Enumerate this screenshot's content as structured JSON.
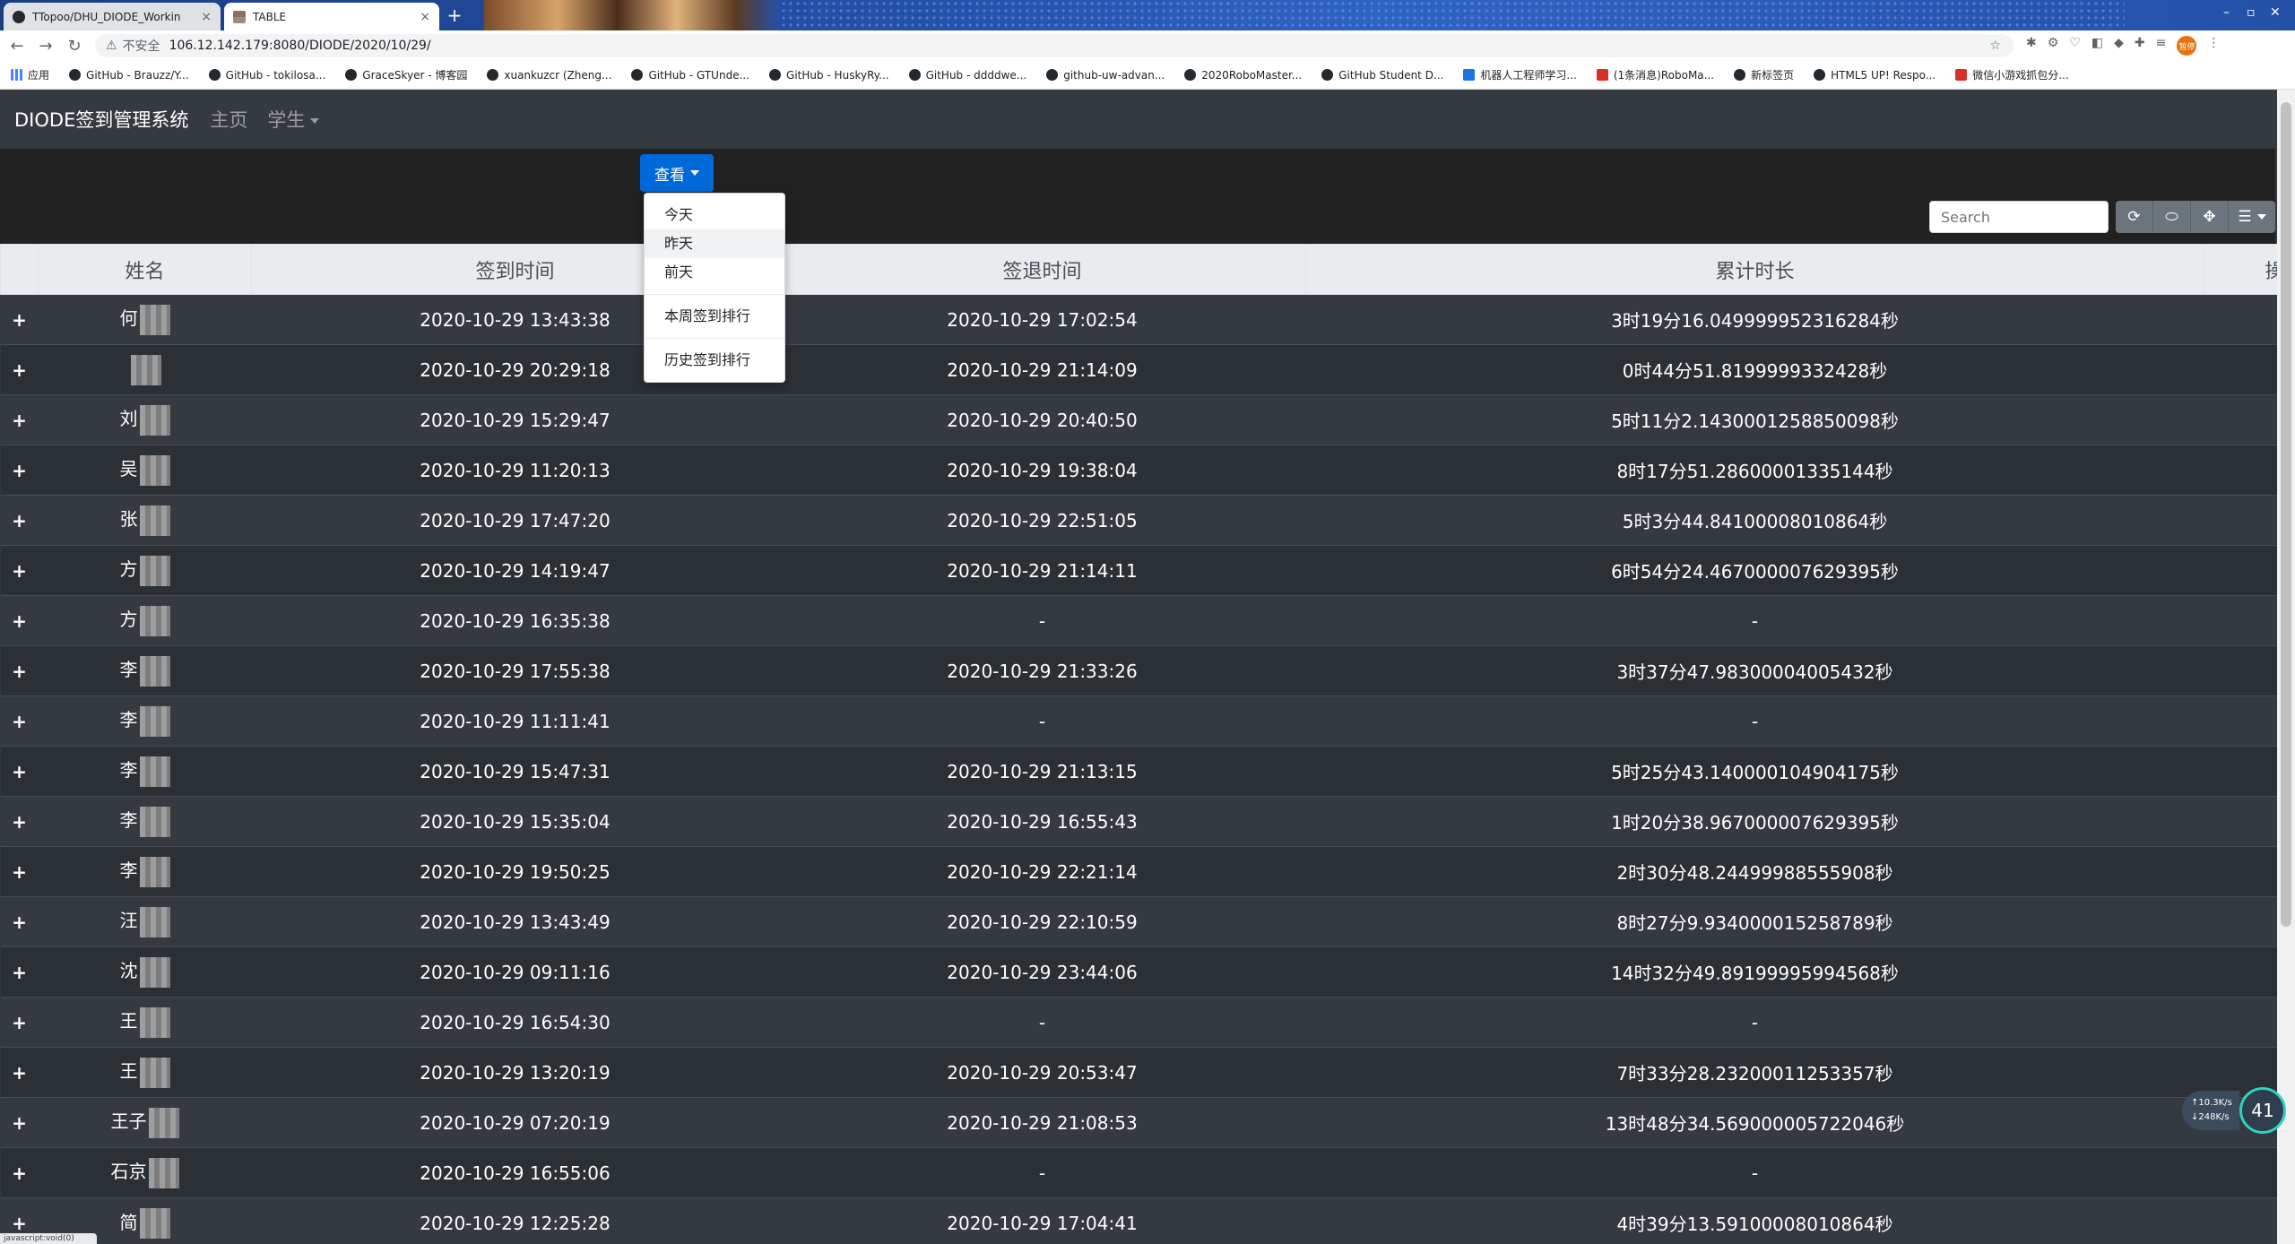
{
  "browser": {
    "tabs": [
      {
        "title": "TTopoo/DHU_DIODE_Workin",
        "close": "×"
      },
      {
        "title": "TABLE",
        "close": "×"
      }
    ],
    "new_tab": "+",
    "address": {
      "insecure_label": "不安全",
      "url": "106.12.142.179:8080/DIODE/2020/10/29/"
    },
    "profile_chip": "暂停",
    "bookmarks": [
      "应用",
      "GitHub - Brauzz/Y...",
      "GitHub - tokilosa...",
      "GraceSkyer - 博客园",
      "xuankuzcr (Zheng...",
      "GitHub - GTUnde...",
      "GitHub - HuskyRy...",
      "GitHub - ddddwe...",
      "github-uw-advan...",
      "2020RoboMaster...",
      "GitHub Student D...",
      "机器人工程师学习...",
      "(1条消息)RoboMa...",
      "新标签页",
      "HTML5 UP! Respo...",
      "微信小游戏抓包分..."
    ],
    "status_url": "javascript:void(0)"
  },
  "navbar": {
    "brand": "DIODE签到管理系统",
    "home": "主页",
    "student": "学生"
  },
  "toolbar": {
    "view_button": "查看",
    "search_placeholder": "Search",
    "icons": [
      "refresh-icon",
      "toggle-icon",
      "fullscreen-icon",
      "columns-icon"
    ]
  },
  "dropdown": {
    "items": [
      "今天",
      "昨天",
      "前天",
      "本周签到排行",
      "历史签到排行"
    ],
    "hovered": "昨天"
  },
  "table": {
    "columns": [
      "姓名",
      "签到时间",
      "签退时间",
      "累计时长",
      "操作"
    ],
    "rows": [
      {
        "name": "何",
        "checkin": "2020-10-29 13:43:38",
        "checkout": "2020-10-29 17:02:54",
        "duration": "3时19分16.049999952316284秒"
      },
      {
        "name": "",
        "checkin": "2020-10-29 20:29:18",
        "checkout": "2020-10-29 21:14:09",
        "duration": "0时44分51.8199999332428秒"
      },
      {
        "name": "刘",
        "checkin": "2020-10-29 15:29:47",
        "checkout": "2020-10-29 20:40:50",
        "duration": "5时11分2.1430001258850098秒"
      },
      {
        "name": "吴",
        "checkin": "2020-10-29 11:20:13",
        "checkout": "2020-10-29 19:38:04",
        "duration": "8时17分51.28600001335144秒"
      },
      {
        "name": "张",
        "checkin": "2020-10-29 17:47:20",
        "checkout": "2020-10-29 22:51:05",
        "duration": "5时3分44.84100008010864秒"
      },
      {
        "name": "方",
        "checkin": "2020-10-29 14:19:47",
        "checkout": "2020-10-29 21:14:11",
        "duration": "6时54分24.467000007629395秒"
      },
      {
        "name": "方",
        "checkin": "2020-10-29 16:35:38",
        "checkout": "-",
        "duration": "-"
      },
      {
        "name": "李",
        "checkin": "2020-10-29 17:55:38",
        "checkout": "2020-10-29 21:33:26",
        "duration": "3时37分47.98300004005432秒"
      },
      {
        "name": "李",
        "checkin": "2020-10-29 11:11:41",
        "checkout": "-",
        "duration": "-"
      },
      {
        "name": "李",
        "checkin": "2020-10-29 15:47:31",
        "checkout": "2020-10-29 21:13:15",
        "duration": "5时25分43.140000104904175秒"
      },
      {
        "name": "李",
        "checkin": "2020-10-29 15:35:04",
        "checkout": "2020-10-29 16:55:43",
        "duration": "1时20分38.967000007629395秒"
      },
      {
        "name": "李",
        "checkin": "2020-10-29 19:50:25",
        "checkout": "2020-10-29 22:21:14",
        "duration": "2时30分48.24499988555908秒"
      },
      {
        "name": "汪",
        "checkin": "2020-10-29 13:43:49",
        "checkout": "2020-10-29 22:10:59",
        "duration": "8时27分9.934000015258789秒"
      },
      {
        "name": "沈",
        "checkin": "2020-10-29 09:11:16",
        "checkout": "2020-10-29 23:44:06",
        "duration": "14时32分49.89199995994568秒"
      },
      {
        "name": "王",
        "checkin": "2020-10-29 16:54:30",
        "checkout": "-",
        "duration": "-"
      },
      {
        "name": "王",
        "checkin": "2020-10-29 13:20:19",
        "checkout": "2020-10-29 20:53:47",
        "duration": "7时33分28.23200011253357秒"
      },
      {
        "name": "王子",
        "checkin": "2020-10-29 07:20:19",
        "checkout": "2020-10-29 21:08:53",
        "duration": "13时48分34.569000005722046秒"
      },
      {
        "name": "石京",
        "checkin": "2020-10-29 16:55:06",
        "checkout": "-",
        "duration": "-"
      },
      {
        "name": "简",
        "checkin": "2020-10-29 12:25:28",
        "checkout": "2020-10-29 17:04:41",
        "duration": "4时39分13.59100008010864秒"
      }
    ]
  },
  "netmon": {
    "up": "↑10.3K/s",
    "down": "↓248K/s",
    "percent": "41"
  },
  "colors": {
    "accent": "#0069d9",
    "plus": "#1e90ff",
    "trash": "#1e90ff",
    "navbar": "#343a40"
  }
}
